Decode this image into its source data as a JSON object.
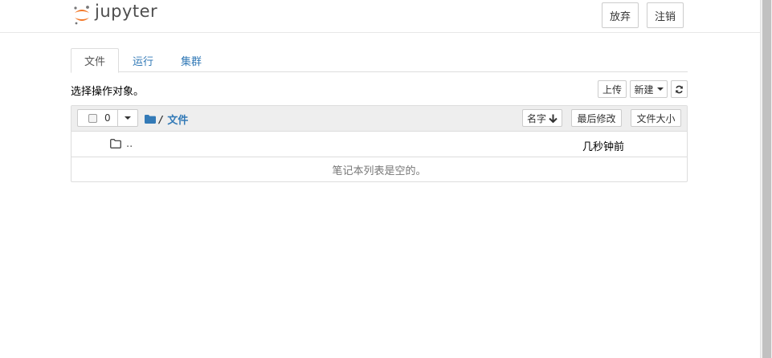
{
  "header": {
    "logo_text": "jupyter",
    "quit_label": "放弃",
    "logout_label": "注销"
  },
  "tabs": [
    {
      "label": "文件",
      "active": true
    },
    {
      "label": "运行",
      "active": false
    },
    {
      "label": "集群",
      "active": false
    }
  ],
  "toolbar": {
    "select_hint": "选择操作对象。",
    "upload_label": "上传",
    "new_label": "新建",
    "refresh_icon": "refresh-icon"
  },
  "list": {
    "selected_count": "0",
    "breadcrumb_sep": "/",
    "breadcrumb_current": "文件",
    "sort_name_label": "名字",
    "sort_modified_label": "最后修改",
    "sort_size_label": "文件大小",
    "parent_name": "..",
    "parent_modified": "几秒钟前",
    "empty_message": "笔记本列表是空的。"
  },
  "colors": {
    "link": "#337ab7",
    "logo_orange": "#f37726",
    "header_bg": "#eeeeee"
  }
}
